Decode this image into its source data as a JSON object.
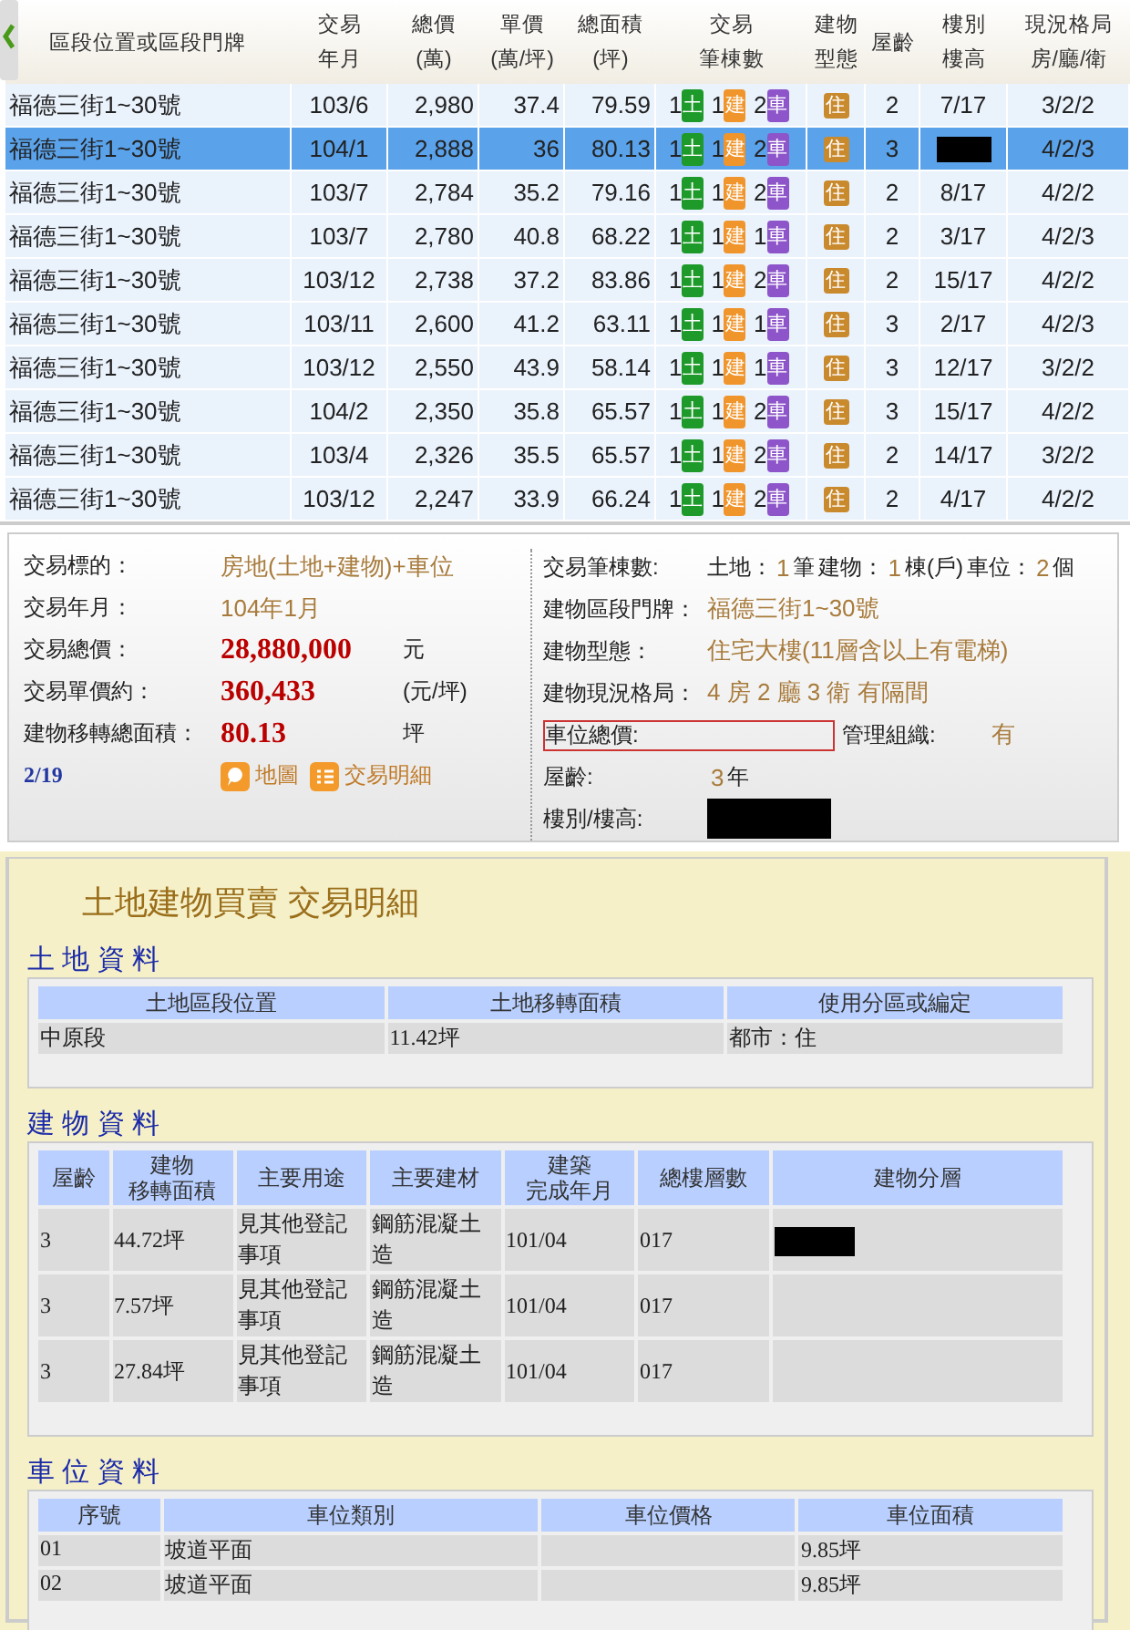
{
  "list": {
    "columns": [
      {
        "lines": [
          "區段位置或區段門牌"
        ]
      },
      {
        "lines": [
          "交易",
          "年月"
        ]
      },
      {
        "lines": [
          "總價",
          "(萬)"
        ]
      },
      {
        "lines": [
          "單價",
          "(萬/坪)"
        ]
      },
      {
        "lines": [
          "總面積",
          "(坪)"
        ]
      },
      {
        "lines": [
          "交易",
          "筆棟數"
        ]
      },
      {
        "lines": [
          "建物",
          "型態"
        ]
      },
      {
        "lines": [
          "屋齡"
        ]
      },
      {
        "lines": [
          "樓別",
          "樓高"
        ]
      },
      {
        "lines": [
          "現況格局",
          "房/廳/衛"
        ]
      }
    ],
    "rows": [
      {
        "selected": false,
        "address": "福德三街1~30號",
        "date": "103/6",
        "total": "2,980",
        "unit": "37.4",
        "area": "79.59",
        "deals": [
          {
            "kind": "land",
            "count": "1",
            "tag": "土"
          },
          {
            "kind": "building",
            "count": "1",
            "tag": "建"
          },
          {
            "kind": "parking",
            "count": "2",
            "tag": "車"
          }
        ],
        "type": "住",
        "age": "2",
        "floor": "7/17",
        "layout": "3/2/2"
      },
      {
        "selected": true,
        "address": "福德三街1~30號",
        "date": "104/1",
        "total": "2,888",
        "unit": "36",
        "area": "80.13",
        "deals": [
          {
            "kind": "land",
            "count": "1",
            "tag": "土"
          },
          {
            "kind": "building",
            "count": "1",
            "tag": "建"
          },
          {
            "kind": "parking",
            "count": "2",
            "tag": "車"
          }
        ],
        "type": "住",
        "age": "3",
        "floor_redacted": true,
        "layout": "4/2/3"
      },
      {
        "selected": false,
        "address": "福德三街1~30號",
        "date": "103/7",
        "total": "2,784",
        "unit": "35.2",
        "area": "79.16",
        "deals": [
          {
            "kind": "land",
            "count": "1",
            "tag": "土"
          },
          {
            "kind": "building",
            "count": "1",
            "tag": "建"
          },
          {
            "kind": "parking",
            "count": "2",
            "tag": "車"
          }
        ],
        "type": "住",
        "age": "2",
        "floor": "8/17",
        "layout": "4/2/2"
      },
      {
        "selected": false,
        "address": "福德三街1~30號",
        "date": "103/7",
        "total": "2,780",
        "unit": "40.8",
        "area": "68.22",
        "deals": [
          {
            "kind": "land",
            "count": "1",
            "tag": "土"
          },
          {
            "kind": "building",
            "count": "1",
            "tag": "建"
          },
          {
            "kind": "parking",
            "count": "1",
            "tag": "車"
          }
        ],
        "type": "住",
        "age": "2",
        "floor": "3/17",
        "layout": "4/2/3"
      },
      {
        "selected": false,
        "address": "福德三街1~30號",
        "date": "103/12",
        "total": "2,738",
        "unit": "37.2",
        "area": "83.86",
        "deals": [
          {
            "kind": "land",
            "count": "1",
            "tag": "土"
          },
          {
            "kind": "building",
            "count": "1",
            "tag": "建"
          },
          {
            "kind": "parking",
            "count": "2",
            "tag": "車"
          }
        ],
        "type": "住",
        "age": "2",
        "floor": "15/17",
        "layout": "4/2/2"
      },
      {
        "selected": false,
        "address": "福德三街1~30號",
        "date": "103/11",
        "total": "2,600",
        "unit": "41.2",
        "area": "63.11",
        "deals": [
          {
            "kind": "land",
            "count": "1",
            "tag": "土"
          },
          {
            "kind": "building",
            "count": "1",
            "tag": "建"
          },
          {
            "kind": "parking",
            "count": "1",
            "tag": "車"
          }
        ],
        "type": "住",
        "age": "3",
        "floor": "2/17",
        "layout": "4/2/3"
      },
      {
        "selected": false,
        "address": "福德三街1~30號",
        "date": "103/12",
        "total": "2,550",
        "unit": "43.9",
        "area": "58.14",
        "deals": [
          {
            "kind": "land",
            "count": "1",
            "tag": "土"
          },
          {
            "kind": "building",
            "count": "1",
            "tag": "建"
          },
          {
            "kind": "parking",
            "count": "1",
            "tag": "車"
          }
        ],
        "type": "住",
        "age": "3",
        "floor": "12/17",
        "layout": "3/2/2"
      },
      {
        "selected": false,
        "address": "福德三街1~30號",
        "date": "104/2",
        "total": "2,350",
        "unit": "35.8",
        "area": "65.57",
        "deals": [
          {
            "kind": "land",
            "count": "1",
            "tag": "土"
          },
          {
            "kind": "building",
            "count": "1",
            "tag": "建"
          },
          {
            "kind": "parking",
            "count": "2",
            "tag": "車"
          }
        ],
        "type": "住",
        "age": "3",
        "floor": "15/17",
        "layout": "4/2/2"
      },
      {
        "selected": false,
        "address": "福德三街1~30號",
        "date": "103/4",
        "total": "2,326",
        "unit": "35.5",
        "area": "65.57",
        "deals": [
          {
            "kind": "land",
            "count": "1",
            "tag": "土"
          },
          {
            "kind": "building",
            "count": "1",
            "tag": "建"
          },
          {
            "kind": "parking",
            "count": "2",
            "tag": "車"
          }
        ],
        "type": "住",
        "age": "2",
        "floor": "14/17",
        "layout": "3/2/2"
      },
      {
        "selected": false,
        "address": "福德三街1~30號",
        "date": "103/12",
        "total": "2,247",
        "unit": "33.9",
        "area": "66.24",
        "deals": [
          {
            "kind": "land",
            "count": "1",
            "tag": "土"
          },
          {
            "kind": "building",
            "count": "1",
            "tag": "建"
          },
          {
            "kind": "parking",
            "count": "2",
            "tag": "車"
          }
        ],
        "type": "住",
        "age": "2",
        "floor": "4/17",
        "layout": "4/2/2"
      }
    ]
  },
  "detail": {
    "left": [
      {
        "kind": "plain",
        "label": "交易標的：",
        "value": "房地(土地+建物)+車位"
      },
      {
        "kind": "plain",
        "label": "交易年月：",
        "value": "104年1月"
      },
      {
        "kind": "big",
        "label": "交易總價：",
        "value": "28,880,000",
        "unit": "元"
      },
      {
        "kind": "big",
        "label": "交易單價約：",
        "value": "360,433",
        "unit": "(元/坪)"
      },
      {
        "kind": "big",
        "label": "建物移轉總面積：",
        "value": "80.13",
        "unit": "坪"
      }
    ],
    "pager": "2/19",
    "map_link": "地圖",
    "detail_link": "交易明細",
    "counts_label": "交易筆棟數:",
    "counts": [
      {
        "label": "土地：",
        "value": "1",
        "unit": "筆"
      },
      {
        "label": "建物：",
        "value": "1",
        "unit": "棟(戶)"
      },
      {
        "label": "車位：",
        "value": "2",
        "unit": "個"
      }
    ],
    "right": [
      {
        "label": "建物區段門牌：",
        "value": "福德三街1~30號"
      },
      {
        "label": "建物型態：",
        "value": "住宅大樓(11層含以上有電梯)"
      },
      {
        "label": "建物現況格局：",
        "value": "4 房 2 廳 3 衛 有隔間"
      }
    ],
    "parking_price_label": "車位總價:",
    "management_label": "管理組織:",
    "management_value": "有",
    "age_label": "屋齡:",
    "age_value": "3",
    "age_unit": "年",
    "floor_label": "樓別/樓高:",
    "floor_redacted": true
  },
  "sheet": {
    "title": "土地建物買賣 交易明細",
    "sections": [
      {
        "heading": "土 地 資 料",
        "columns": [
          {
            "lines": [
              "土地區段位置"
            ]
          },
          {
            "lines": [
              "土地移轉面積"
            ]
          },
          {
            "lines": [
              "使用分區或編定"
            ]
          }
        ],
        "rows": [
          {
            "cells": [
              "中原段",
              "11.42坪",
              "都市：住"
            ]
          }
        ]
      },
      {
        "heading": "建 物 資 料",
        "columns": [
          {
            "lines": [
              "屋齡"
            ]
          },
          {
            "lines": [
              "建物",
              "移轉面積"
            ]
          },
          {
            "lines": [
              "主要用途"
            ]
          },
          {
            "lines": [
              "主要建材"
            ]
          },
          {
            "lines": [
              "建築",
              "完成年月"
            ]
          },
          {
            "lines": [
              "總樓層數"
            ]
          },
          {
            "lines": [
              "建物分層"
            ]
          }
        ],
        "rows": [
          {
            "cells": [
              "3",
              "44.72坪",
              "見其他登記事項",
              "鋼筋混凝土造",
              "101/04",
              "017"
            ],
            "redacted": true
          },
          {
            "cells": [
              "3",
              "7.57坪",
              "見其他登記事項",
              "鋼筋混凝土造",
              "101/04",
              "017"
            ],
            "redacted": false
          },
          {
            "cells": [
              "3",
              "27.84坪",
              "見其他登記事項",
              "鋼筋混凝土造",
              "101/04",
              "017"
            ],
            "redacted": false
          }
        ]
      },
      {
        "heading": "車 位 資 料",
        "columns": [
          {
            "lines": [
              "序號"
            ]
          },
          {
            "lines": [
              "車位類別"
            ]
          },
          {
            "lines": [
              "車位價格"
            ]
          },
          {
            "lines": [
              "車位面積"
            ]
          }
        ],
        "rows": [
          {
            "cells": [
              "01",
              "坡道平面",
              "",
              "9.85坪"
            ]
          },
          {
            "cells": [
              "02",
              "坡道平面",
              "",
              "9.85坪"
            ]
          }
        ]
      }
    ]
  }
}
